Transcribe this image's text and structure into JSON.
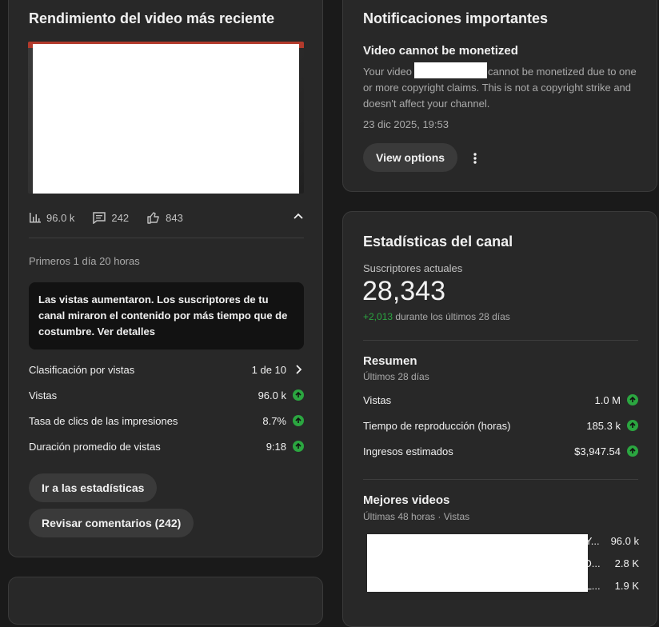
{
  "recent_video": {
    "title": "Rendimiento del video más reciente",
    "views": "96.0 k",
    "comments": "242",
    "likes": "843",
    "period": "Primeros 1 día 20 horas",
    "insight": "Las vistas aumentaron. Los suscriptores de tu canal miraron el contenido por más tiempo que de costumbre. Ver detalles",
    "metrics": [
      {
        "label": "Clasificación por vistas",
        "value": "1 de 10"
      },
      {
        "label": "Vistas",
        "value": "96.0 k"
      },
      {
        "label": "Tasa de clics de las impresiones",
        "value": "8.7%"
      },
      {
        "label": "Duración promedio de vistas",
        "value": "9:18"
      }
    ],
    "btn_analytics": "Ir a las estadísticas",
    "btn_comments": "Revisar comentarios (242)"
  },
  "notifications": {
    "title": "Notificaciones importantes",
    "headline": "Video cannot be monetized",
    "body_prefix": "Your video",
    "body_suffix": "cannot be monetized due to one or more copyright claims. This is not a copyright strike and doesn't affect your channel.",
    "time": "23 dic 2025, 19:53",
    "view_options": "View options"
  },
  "channel": {
    "title": "Estadísticas del canal",
    "subs_label": "Suscriptores actuales",
    "subs_count": "28,343",
    "subs_delta": "+2,013",
    "subs_delta_suffix": "durante los últimos 28 días",
    "summary_title": "Resumen",
    "summary_sub": "Últimos 28 días",
    "summary": [
      {
        "label": "Vistas",
        "value": "1.0 M"
      },
      {
        "label": "Tiempo de reproducción (horas)",
        "value": "185.3 k"
      },
      {
        "label": "Ingresos estimados",
        "value": "$3,947.54"
      }
    ],
    "top_title": "Mejores videos",
    "top_sub": "Últimas 48 horas · Vistas",
    "top_videos": [
      {
        "title_tail": "Y...",
        "value": "96.0 k"
      },
      {
        "title_tail": "D...",
        "value": "2.8 K"
      },
      {
        "title_tail": "L...",
        "value": "1.9 K"
      }
    ]
  },
  "colors": {
    "accent_green": "#2ba640",
    "card": "#282828",
    "background": "#1a1a1a"
  }
}
